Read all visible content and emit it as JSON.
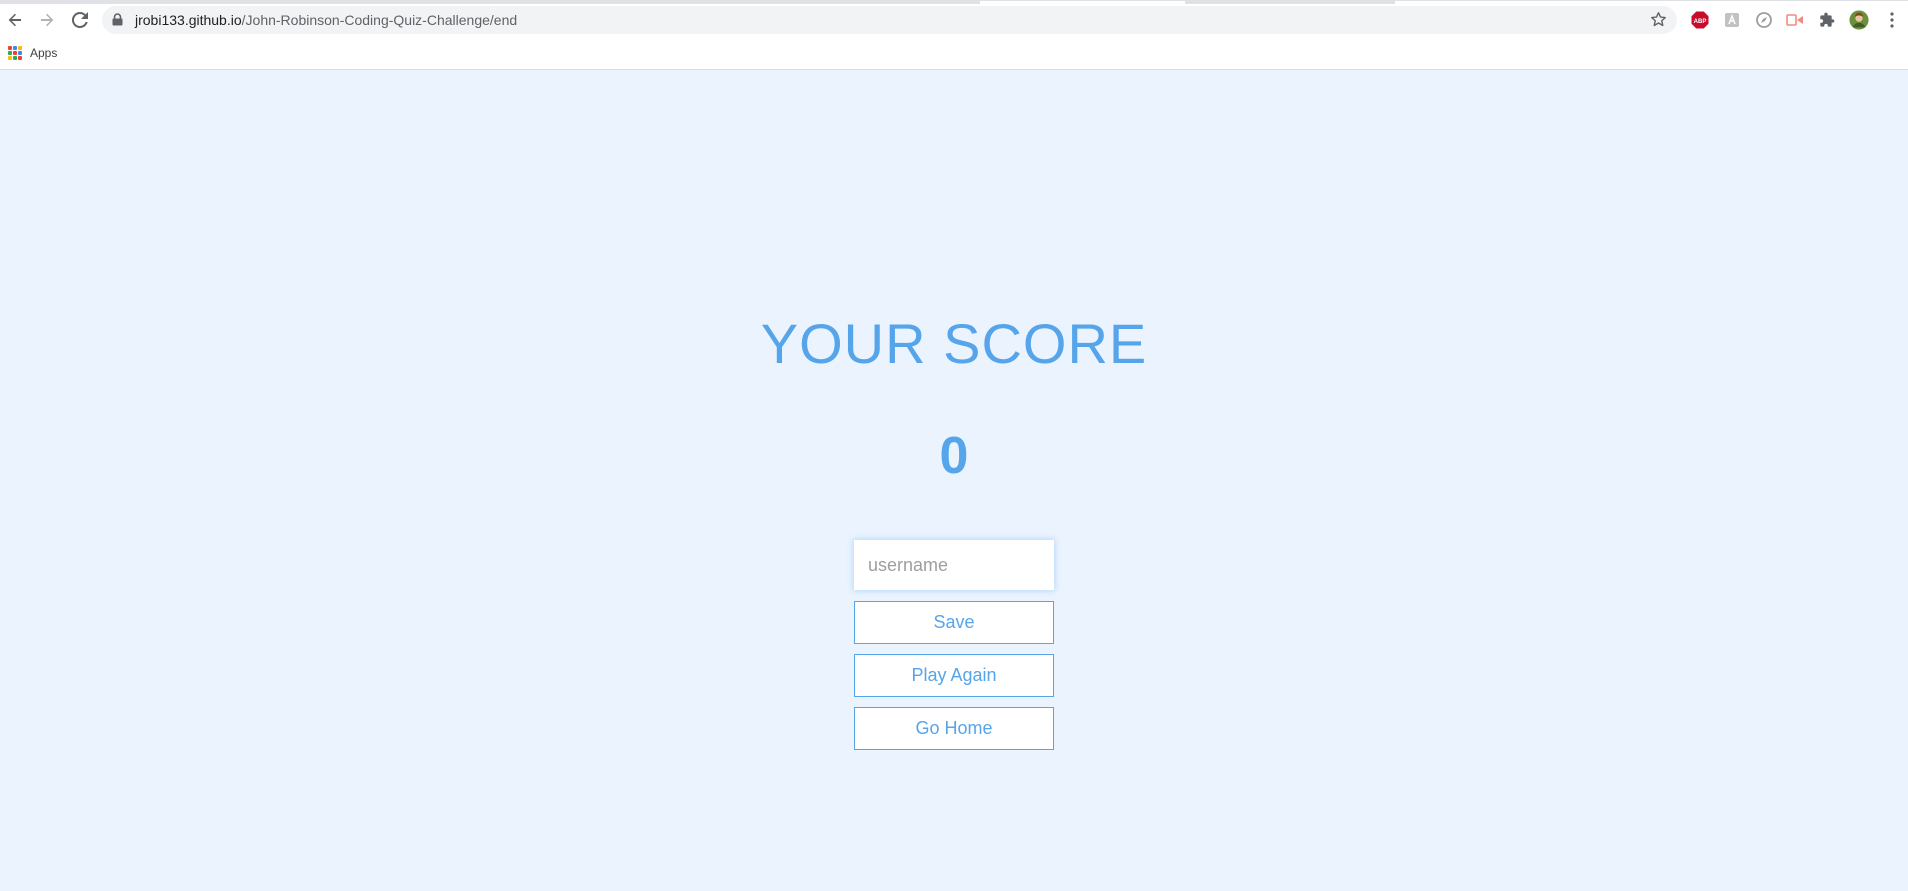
{
  "browser": {
    "url_host": "jrobi133.github.io",
    "url_path": "/John-Robinson-Coding-Quiz-Challenge/end",
    "bookmarks": {
      "apps_label": "Apps"
    },
    "extensions": [
      {
        "icon": "adblock-plus-icon",
        "label": "ABP",
        "color": "#c70d2c"
      },
      {
        "icon": "reader-extension-icon",
        "color": "#bdbdbd"
      },
      {
        "icon": "compass-extension-icon",
        "color": "#9e9e9e"
      },
      {
        "icon": "screencast-extension-icon",
        "color": "#f28b82"
      },
      {
        "icon": "puzzle-extensions-icon",
        "color": "#5f6368"
      },
      {
        "icon": "profile-avatar-icon",
        "color": "#6b8f3a"
      }
    ]
  },
  "page": {
    "heading": "YOUR SCORE",
    "score": "0",
    "username_placeholder": "username",
    "save_label": "Save",
    "play_again_label": "Play Again",
    "go_home_label": "Go Home"
  },
  "colors": {
    "accent": "#56a5eb",
    "background": "#ebf4fe"
  }
}
